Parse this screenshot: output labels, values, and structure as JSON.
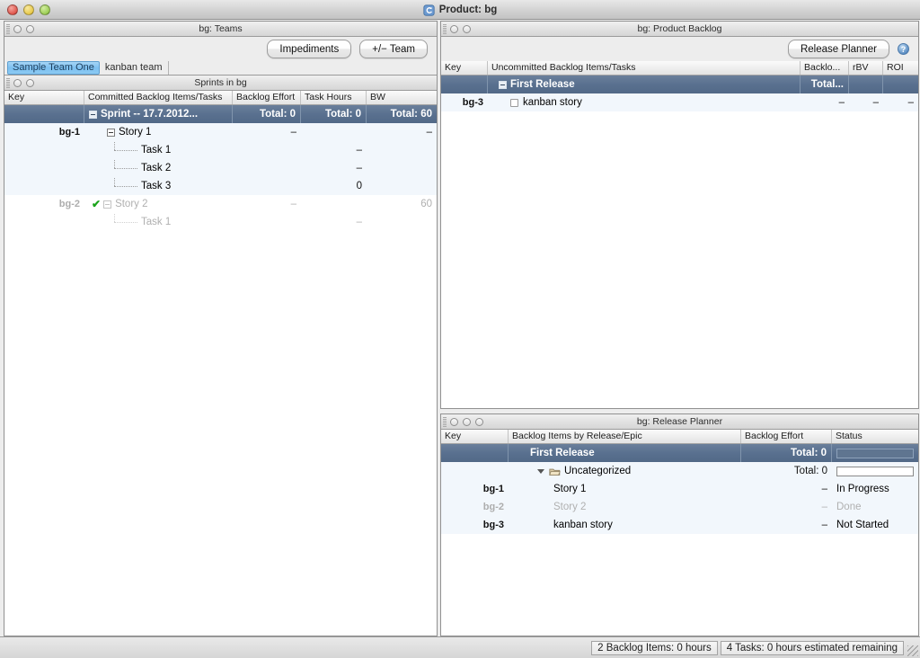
{
  "window": {
    "title": "Product: bg",
    "app_icon": "app-icon",
    "controls": [
      "close",
      "minimize",
      "zoom"
    ]
  },
  "teams_panel": {
    "bar_title": "bg: Teams",
    "buttons": {
      "impediments": "Impediments",
      "team": "+/− Team"
    },
    "tabs": [
      {
        "label": "Sample Team One",
        "selected": true
      },
      {
        "label": "kanban team",
        "selected": false
      }
    ],
    "sprints_bar_title": "Sprints in bg",
    "columns": [
      "Key",
      "Committed Backlog Items/Tasks",
      "Backlog Effort",
      "Task Hours",
      "BW"
    ],
    "rows": [
      {
        "type": "group",
        "key": "",
        "expander": "collapse",
        "indent": 0,
        "name": "Sprint -- 17.7.2012...",
        "effort": "Total: 0",
        "hours": "Total: 0",
        "bw": "Total: 60"
      },
      {
        "type": "item",
        "key": "bg-1",
        "expander": "collapse",
        "indent": 0,
        "name": "Story 1",
        "effort": "–",
        "hours": "",
        "bw": "–",
        "dim": false
      },
      {
        "type": "task",
        "key": "",
        "indent": 1,
        "name": "Task 1",
        "effort": "",
        "hours": "–",
        "bw": "",
        "dim": false
      },
      {
        "type": "task",
        "key": "",
        "indent": 1,
        "name": "Task 2",
        "effort": "",
        "hours": "–",
        "bw": "",
        "dim": false
      },
      {
        "type": "task",
        "key": "",
        "indent": 1,
        "name": "Task 3",
        "effort": "",
        "hours": "0",
        "bw": "",
        "dim": false
      },
      {
        "type": "item",
        "key": "bg-2",
        "expander": "collapse",
        "indent": 0,
        "name": "Story 2",
        "effort": "–",
        "hours": "",
        "bw": "60",
        "dim": true,
        "done": true
      },
      {
        "type": "task",
        "key": "",
        "indent": 1,
        "name": "Task 1",
        "effort": "",
        "hours": "–",
        "bw": "",
        "dim": true
      }
    ]
  },
  "backlog_panel": {
    "bar_title": "bg: Product Backlog",
    "buttons": {
      "release_planner": "Release Planner"
    },
    "help_icon": "help-icon",
    "columns": [
      "Key",
      "Uncommitted Backlog Items/Tasks",
      "Backlo...",
      "rBV",
      "ROI"
    ],
    "rows": [
      {
        "type": "group",
        "key": "",
        "expander": "collapse",
        "name": "First Release",
        "effort": "Total...",
        "rbv": "",
        "roi": ""
      },
      {
        "type": "item",
        "key": "bg-3",
        "checkbox": true,
        "name": "kanban story",
        "effort": "–",
        "rbv": "–",
        "roi": "–"
      }
    ]
  },
  "release_panel": {
    "bar_title": "bg: Release Planner",
    "columns": [
      "Key",
      "Backlog Items by Release/Epic",
      "Backlog Effort",
      "Status"
    ],
    "rows": [
      {
        "type": "group",
        "key": "",
        "indent": 0,
        "name": "First Release",
        "effort": "Total: 0",
        "status": "",
        "progress": true,
        "dim": false
      },
      {
        "type": "folder",
        "key": "",
        "indent": 1,
        "name": "Uncategorized",
        "effort": "Total: 0",
        "status": "",
        "progress": true,
        "dim": false
      },
      {
        "type": "item",
        "key": "bg-1",
        "indent": 2,
        "name": "Story 1",
        "effort": "–",
        "status": "In Progress",
        "dim": false
      },
      {
        "type": "item",
        "key": "bg-2",
        "indent": 2,
        "name": "Story 2",
        "effort": "–",
        "status": "Done",
        "dim": true
      },
      {
        "type": "item",
        "key": "bg-3",
        "indent": 2,
        "name": "kanban story",
        "effort": "–",
        "status": "Not Started",
        "dim": false
      }
    ]
  },
  "statusbar": {
    "backlog_items": "2 Backlog Items: 0 hours",
    "tasks": "4 Tasks: 0 hours estimated remaining"
  }
}
